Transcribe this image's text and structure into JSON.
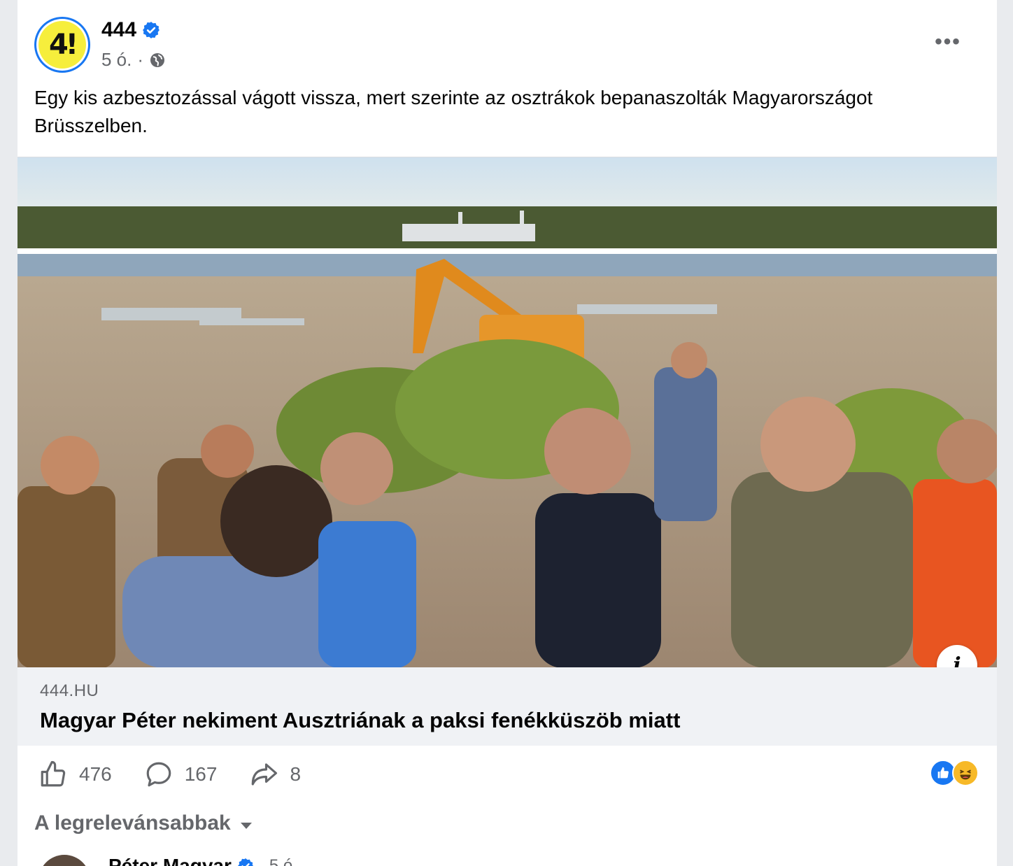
{
  "post": {
    "author": "444",
    "time": "5 ó.",
    "separator": "·",
    "avatar_text": "4!",
    "text": "Egy kis azbesztozással vágott vissza, mert szerinte az osztrákok bepanaszolták Magyarországot Brüsszelben."
  },
  "link": {
    "domain": "444.HU",
    "title": "Magyar Péter nekiment Ausztriának a paksi fenékküszöb miatt"
  },
  "actions": {
    "likes": "476",
    "comments": "167",
    "shares": "8"
  },
  "sort": {
    "label": "A legrelevánsabbak"
  },
  "comment": {
    "author": "Péter Magyar",
    "time": "5 ó."
  },
  "icons": {
    "verified": "verified-badge-icon",
    "globe": "globe-icon",
    "more": "more-options-icon",
    "like": "thumbs-up-icon",
    "comment": "comment-bubble-icon",
    "share": "share-arrow-icon",
    "info": "info-icon"
  },
  "colors": {
    "accent": "#1877f2",
    "muted": "#65676b",
    "logo_yellow": "#f6ee3c"
  }
}
